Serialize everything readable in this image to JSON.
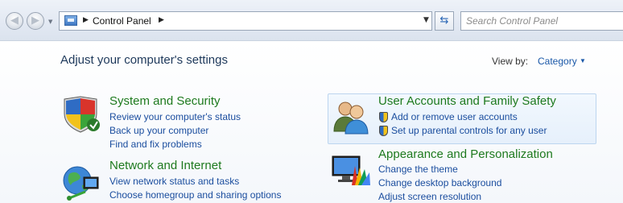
{
  "nav": {
    "back_glyph": "◀",
    "forward_glyph": "▶",
    "history_glyph": "▼"
  },
  "address": {
    "location": "Control Panel",
    "separator": "▶",
    "dropdown_glyph": "▼"
  },
  "refresh_glyph": "⇆",
  "search": {
    "placeholder": "Search Control Panel"
  },
  "main": {
    "heading": "Adjust your computer's settings",
    "view_by_label": "View by:",
    "view_by_value": "Category",
    "view_by_arrow": "▼"
  },
  "categories": {
    "system_security": {
      "title": "System and Security",
      "links": [
        "Review your computer's status",
        "Back up your computer",
        "Find and fix problems"
      ]
    },
    "network_internet": {
      "title": "Network and Internet",
      "links": [
        "View network status and tasks",
        "Choose homegroup and sharing options"
      ]
    },
    "user_accounts": {
      "title": "User Accounts and Family Safety",
      "links": [
        "Add or remove user accounts",
        "Set up parental controls for any user"
      ]
    },
    "appearance": {
      "title": "Appearance and Personalization",
      "links": [
        "Change the theme",
        "Change desktop background",
        "Adjust screen resolution"
      ]
    }
  },
  "colors": {
    "link": "#1a4d9e",
    "category_title": "#1e7a1e",
    "heading": "#1e395b"
  }
}
